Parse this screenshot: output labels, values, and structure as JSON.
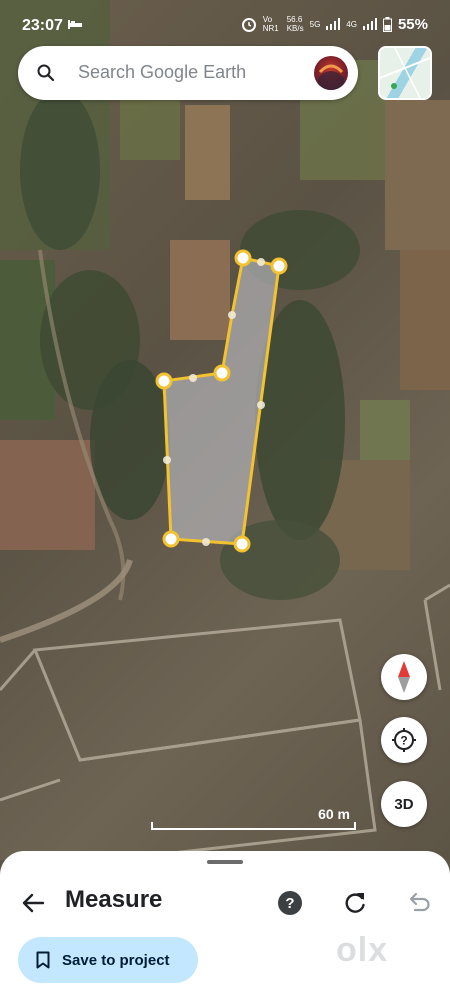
{
  "status_bar": {
    "time": "23:07",
    "network_label": "Vo NR1",
    "speed_value": "56.6",
    "speed_unit": "KB/s",
    "network_type_1": "5G",
    "network_type_2": "4G",
    "battery_percent": "55%"
  },
  "search": {
    "placeholder": "Search Google Earth"
  },
  "map": {
    "scale_label": "60 m",
    "polygon_fill": "#b3b3b8",
    "polygon_stroke": "#f2c230"
  },
  "controls": {
    "three_d_label": "3D",
    "compass_north_color": "#e53935"
  },
  "sheet": {
    "title": "Measure",
    "help_label": "?",
    "save_label": "Save to project",
    "accent_color": "#c2e7ff"
  },
  "watermark": {
    "text": "olx"
  },
  "icons": {
    "search": "search-icon",
    "back": "back-arrow-icon",
    "help": "help-icon",
    "redo": "redo-icon",
    "undo": "undo-icon",
    "bookmark": "bookmark-icon",
    "location": "location-icon",
    "compass": "compass-icon"
  }
}
